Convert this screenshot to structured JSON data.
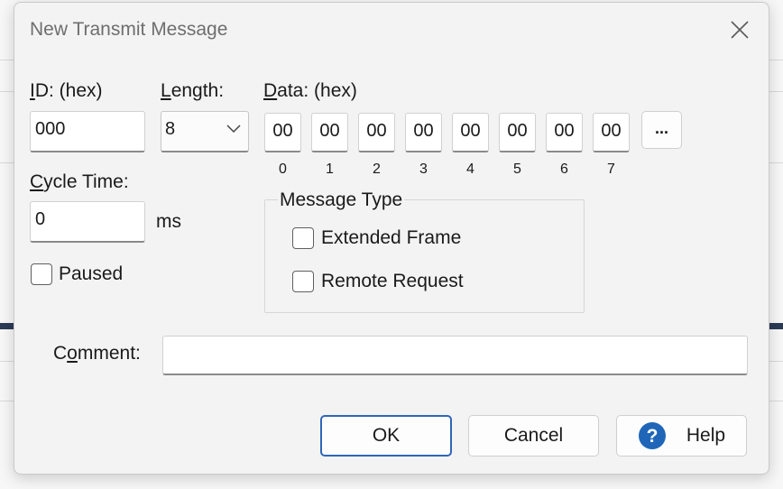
{
  "dialog": {
    "title": "New Transmit Message"
  },
  "id_field": {
    "label_u": "I",
    "label_rest": "D: (hex)",
    "value": "000"
  },
  "length_field": {
    "label_u": "L",
    "label_rest": "ength:",
    "value": "8"
  },
  "data_field": {
    "label_u": "D",
    "label_rest": "ata: (hex)",
    "bytes": [
      "00",
      "00",
      "00",
      "00",
      "00",
      "00",
      "00",
      "00"
    ],
    "indices": [
      "0",
      "1",
      "2",
      "3",
      "4",
      "5",
      "6",
      "7"
    ],
    "more_label": "..."
  },
  "cycle_time": {
    "label_u": "C",
    "label_rest": "ycle Time:",
    "value": "0",
    "unit": "ms"
  },
  "paused": {
    "label": "Paused",
    "checked": false
  },
  "message_type": {
    "title": "Message Type",
    "extended_frame": {
      "label": "Extended Frame",
      "checked": false
    },
    "remote_request": {
      "label": "Remote Request",
      "checked": false
    }
  },
  "comment": {
    "label_pre": "C",
    "label_u": "o",
    "label_rest": "mment:",
    "value": ""
  },
  "buttons": {
    "ok": "OK",
    "cancel": "Cancel",
    "help": "Help"
  },
  "colors": {
    "help_icon": "#1f66b8",
    "default_button_border": "#2f66b8"
  }
}
